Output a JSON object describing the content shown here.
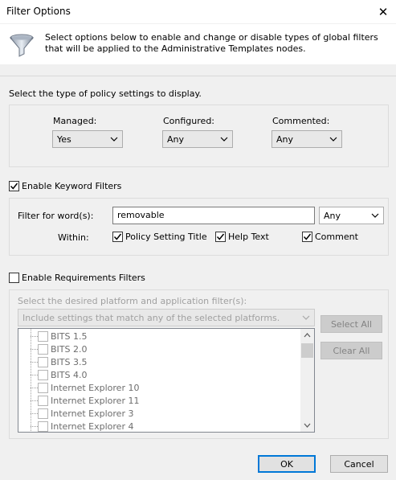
{
  "window": {
    "title": "Filter Options",
    "close_glyph": "✕"
  },
  "header": {
    "icon": "funnel-icon",
    "description": "Select options below to enable and change or disable types of global filters that will be applied to the Administrative Templates nodes."
  },
  "policy_type": {
    "heading": "Select the type of policy settings to display.",
    "managed": {
      "label": "Managed:",
      "value": "Yes"
    },
    "configured": {
      "label": "Configured:",
      "value": "Any"
    },
    "commented": {
      "label": "Commented:",
      "value": "Any"
    }
  },
  "keyword_filters": {
    "enable_label": "Enable Keyword Filters",
    "enabled": true,
    "filter_label": "Filter for word(s):",
    "filter_value": "removable",
    "match_value": "Any",
    "within_label": "Within:",
    "policy_setting_title": {
      "label": "Policy Setting Title",
      "checked": true
    },
    "help_text": {
      "label": "Help Text",
      "checked": true
    },
    "comment": {
      "label": "Comment",
      "checked": true
    }
  },
  "requirements_filters": {
    "enable_label": "Enable Requirements Filters",
    "enabled": false,
    "instruction": "Select the desired platform and application filter(s):",
    "match_mode": "Include settings that match any of the selected platforms.",
    "platforms": [
      "BITS 1.5",
      "BITS 2.0",
      "BITS 3.5",
      "BITS 4.0",
      "Internet Explorer 10",
      "Internet Explorer 11",
      "Internet Explorer 3",
      "Internet Explorer 4"
    ],
    "select_all_label": "Select All",
    "clear_all_label": "Clear All"
  },
  "footer": {
    "ok_label": "OK",
    "cancel_label": "Cancel"
  }
}
